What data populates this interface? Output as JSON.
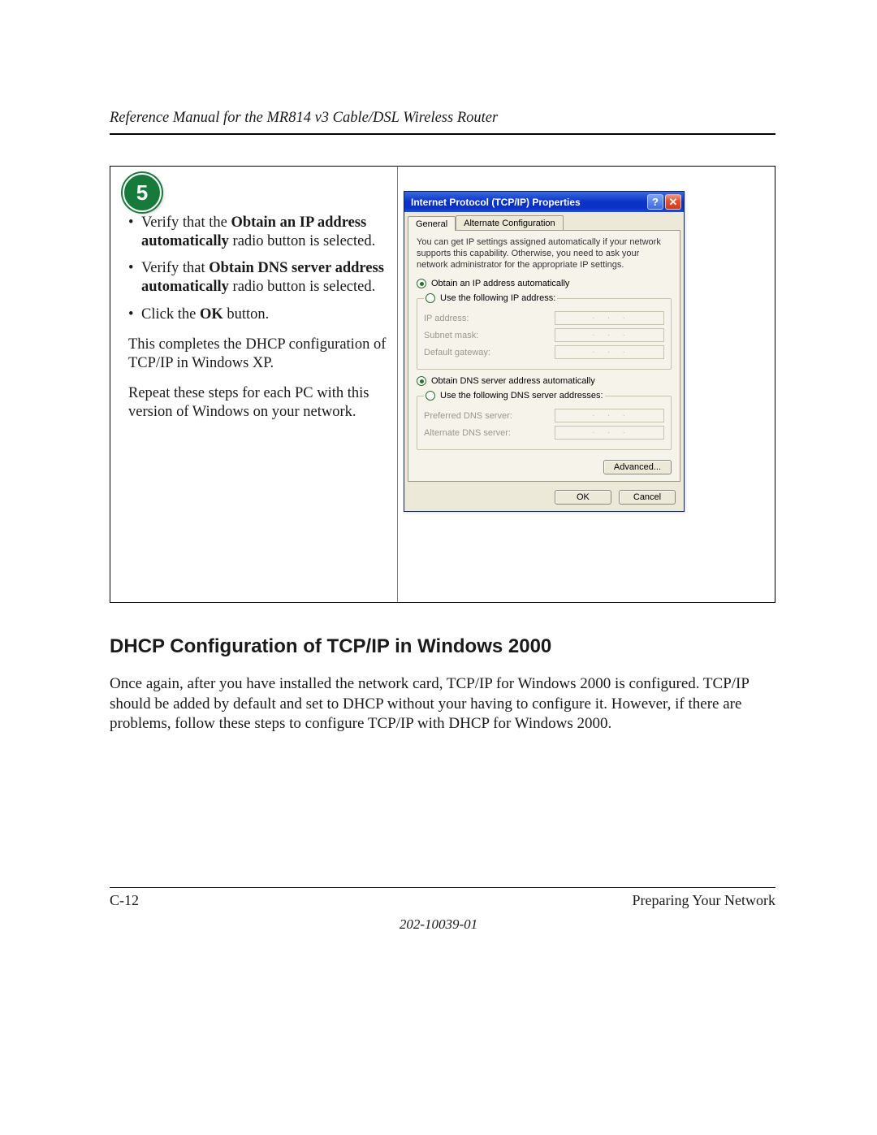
{
  "header": {
    "running_title": "Reference Manual for the MR814 v3 Cable/DSL Wireless Router"
  },
  "step": {
    "number": "5",
    "bullets": {
      "b1": {
        "pre": "Verify that the ",
        "bold": "Obtain an IP address automatically",
        "post": " radio button is selected."
      },
      "b2": {
        "pre": "Verify that ",
        "bold": "Obtain DNS server address automatically",
        "post": " radio button is selected."
      },
      "b3": {
        "pre": "Click the ",
        "bold": "OK",
        "post": " button."
      }
    },
    "p1": "This completes the DHCP configuration of TCP/IP in Windows XP.",
    "p2": "Repeat these steps for each PC with this version of Windows on your network."
  },
  "dialog": {
    "title": "Internet Protocol (TCP/IP) Properties",
    "help_glyph": "?",
    "close_glyph": "✕",
    "tabs": {
      "general": "General",
      "alt": "Alternate Configuration"
    },
    "info": "You can get IP settings assigned automatically if your network supports this capability. Otherwise, you need to ask your network administrator for the appropriate IP settings.",
    "r_obtain_ip": "Obtain an IP address automatically",
    "r_use_ip": "Use the following IP address:",
    "f_ip": "IP address:",
    "f_mask": "Subnet mask:",
    "f_gw": "Default gateway:",
    "r_obtain_dns": "Obtain DNS server address automatically",
    "r_use_dns": "Use the following DNS server addresses:",
    "f_pdns": "Preferred DNS server:",
    "f_adns": "Alternate DNS server:",
    "ip_placeholder": "...",
    "advanced": "Advanced...",
    "ok": "OK",
    "cancel": "Cancel"
  },
  "section": {
    "heading": "DHCP Configuration of TCP/IP in Windows 2000",
    "body": "Once again, after you have installed the network card, TCP/IP for Windows 2000 is configured. TCP/IP should be added by default and set to DHCP without your having to configure it. However, if there are problems, follow these steps to configure TCP/IP with DHCP for Windows 2000."
  },
  "footer": {
    "page": "C-12",
    "chapter": "Preparing Your Network",
    "docnum": "202-10039-01"
  }
}
